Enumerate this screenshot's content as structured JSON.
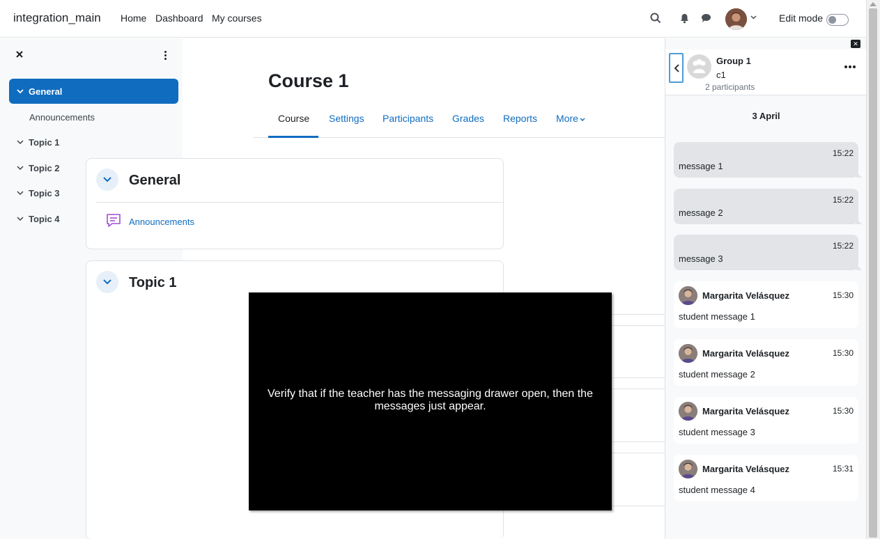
{
  "navbar": {
    "brand": "integration_main",
    "links": [
      "Home",
      "Dashboard",
      "My courses"
    ],
    "edit_mode_label": "Edit mode"
  },
  "course_index": {
    "items": [
      {
        "label": "General",
        "active": true
      },
      {
        "label": "Topic 1"
      },
      {
        "label": "Topic 2"
      },
      {
        "label": "Topic 3"
      },
      {
        "label": "Topic 4"
      }
    ],
    "general_activities": [
      "Announcements"
    ]
  },
  "main": {
    "course_title": "Course 1",
    "tabs": [
      "Course",
      "Settings",
      "Participants",
      "Grades",
      "Reports",
      "More"
    ],
    "sections": [
      {
        "title": "General",
        "activities": [
          "Announcements"
        ]
      },
      {
        "title": "Topic 1"
      }
    ]
  },
  "overlay": {
    "text": "Verify that if the teacher has the messaging drawer open, then the messages just appear."
  },
  "messaging": {
    "group_name": "Group 1",
    "group_short": "c1",
    "participants": "2 participants",
    "date": "3 April",
    "sent": [
      {
        "time": "15:22",
        "text": "message 1"
      },
      {
        "time": "15:22",
        "text": "message 2"
      },
      {
        "time": "15:22",
        "text": "message 3"
      }
    ],
    "received": [
      {
        "sender": "Margarita Velásquez",
        "time": "15:30",
        "text": "student message 1"
      },
      {
        "sender": "Margarita Velásquez",
        "time": "15:30",
        "text": "student message 2"
      },
      {
        "sender": "Margarita Velásquez",
        "time": "15:30",
        "text": "student message 3"
      },
      {
        "sender": "Margarita Velásquez",
        "time": "15:31",
        "text": "student message 4"
      }
    ]
  },
  "colors": {
    "primary": "#0f6cbf",
    "drawer_bg": "#f8f9fa",
    "sent_bubble": "#e2e4e7"
  }
}
